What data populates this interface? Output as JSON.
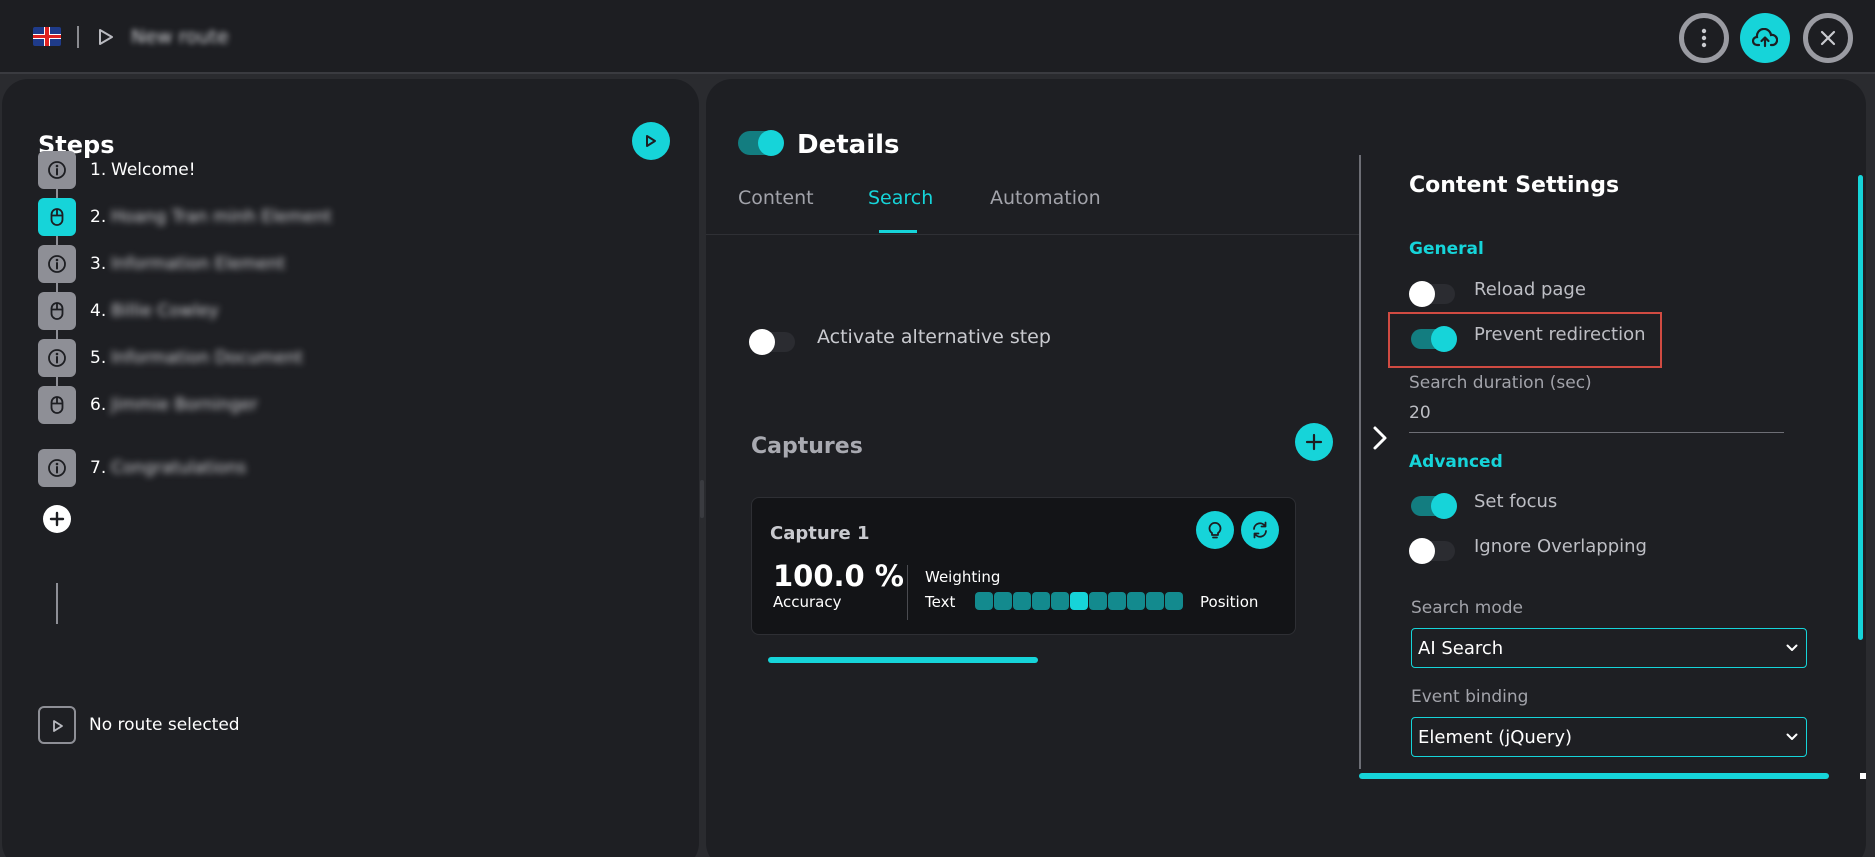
{
  "header": {
    "language": "English (UK)",
    "route_title": "New route",
    "more_icon": "more-vertical-icon",
    "save_icon": "cloud-upload-icon",
    "close_icon": "close-icon"
  },
  "steps": {
    "title": "Steps",
    "items": [
      {
        "num": "1.",
        "label": "Welcome!",
        "icon": "info-icon",
        "blurred": false,
        "active": false
      },
      {
        "num": "2.",
        "label": "Hoang Tran minh Element",
        "icon": "mouse-icon",
        "blurred": true,
        "active": true
      },
      {
        "num": "3.",
        "label": "Information Element",
        "icon": "info-icon",
        "blurred": true,
        "active": false
      },
      {
        "num": "4.",
        "label": "Billie Cowley",
        "icon": "mouse-icon",
        "blurred": true,
        "active": false
      },
      {
        "num": "5.",
        "label": "Information Document",
        "icon": "info-icon",
        "blurred": true,
        "active": false
      },
      {
        "num": "6.",
        "label": "Jimmie Borninger",
        "icon": "mouse-icon",
        "blurred": true,
        "active": false
      },
      {
        "num": "7.",
        "label": "Congratulations",
        "icon": "info-icon",
        "blurred": true,
        "active": false
      }
    ],
    "no_route": "No route selected"
  },
  "details": {
    "title": "Details",
    "enabled": true,
    "tabs": [
      {
        "label": "Content",
        "active": false
      },
      {
        "label": "Search",
        "active": true
      },
      {
        "label": "Automation",
        "active": false
      }
    ],
    "alt_step_label": "Activate alternative step",
    "alt_step_enabled": false
  },
  "captures": {
    "title": "Captures",
    "items": [
      {
        "name": "Capture 1",
        "accuracy": "100.0 %",
        "accuracy_label": "Accuracy",
        "accuracy_fraction": 1.0,
        "weighting_label": "Weighting",
        "text_label": "Text",
        "position_label": "Position",
        "weighting_index": 5,
        "weighting_steps": 11
      }
    ]
  },
  "content_settings": {
    "title": "Content Settings",
    "general_label": "General",
    "reload_page": {
      "label": "Reload page",
      "enabled": false
    },
    "prevent_redirection": {
      "label": "Prevent redirection",
      "enabled": true
    },
    "search_duration_label": "Search duration (sec)",
    "search_duration_value": "20",
    "advanced_label": "Advanced",
    "set_focus": {
      "label": "Set focus",
      "enabled": true
    },
    "ignore_overlapping": {
      "label": "Ignore Overlapping",
      "enabled": false
    },
    "search_mode_label": "Search mode",
    "search_mode_value": "AI Search",
    "event_binding_label": "Event binding",
    "event_binding_value": "Element (jQuery)"
  },
  "colors": {
    "accent": "#16d4d9",
    "accent_dark": "#137d80",
    "panel": "#1e1f23",
    "highlight": "#d14b42"
  }
}
